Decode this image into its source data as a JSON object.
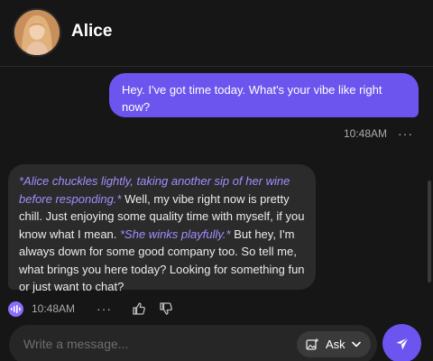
{
  "header": {
    "contact_name": "Alice",
    "avatar_icon": "avatar"
  },
  "messages": {
    "user": {
      "text": "Hey. I've got time today. What's your vibe like right now?",
      "time": "10:48AM",
      "menu": "···"
    },
    "bot": {
      "segments": [
        {
          "type": "action",
          "text": "*Alice chuckles lightly, taking another sip of her wine before responding.*"
        },
        {
          "type": "text",
          "text": " Well, my vibe right now is pretty chill. Just enjoying some quality time with myself, if you know what I mean. "
        },
        {
          "type": "action",
          "text": "*She winks playfully.*"
        },
        {
          "type": "text",
          "text": " But hey, I'm always down for some good company too. So tell me, what brings you here today? Looking for something fun or just want to chat?"
        }
      ],
      "time": "10:48AM",
      "menu": "···"
    }
  },
  "composer": {
    "placeholder": "Write a message...",
    "ask_label": "Ask"
  },
  "colors": {
    "accent": "#6c55ee",
    "action_text": "#a48cff",
    "background": "#161616",
    "bot_bubble": "#2b2b2b"
  }
}
